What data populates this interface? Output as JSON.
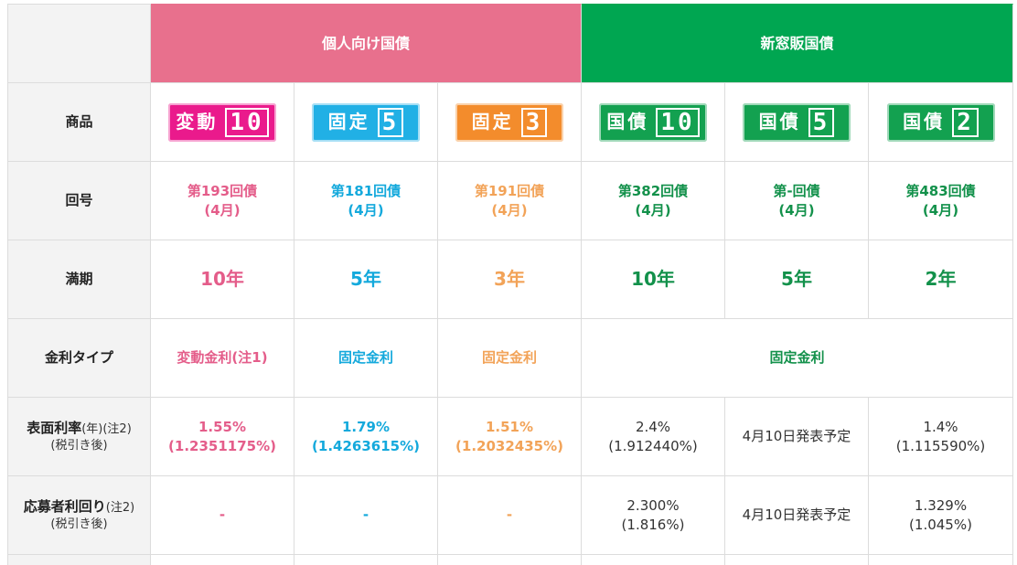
{
  "header": {
    "individual": "個人向け国債",
    "new_window": "新窓販国債"
  },
  "labels": {
    "product": "商品",
    "issue": "回号",
    "maturity": "満期",
    "rate_type": "金利タイプ",
    "coupon_main": "表面利率",
    "coupon_note": "(年)(注2)",
    "coupon_sub": "(税引き後)",
    "yield_main": "応募者利回り",
    "yield_note": "(注2)",
    "yield_sub": "(税引き後)"
  },
  "badges": [
    {
      "text": "変動",
      "num": "10",
      "color": "#ea1a8c"
    },
    {
      "text": "固定",
      "num": "5",
      "color": "#21b0e5"
    },
    {
      "text": "固定",
      "num": "3",
      "color": "#f38c2c"
    },
    {
      "text": "国債",
      "num": "10",
      "color": "#13a150"
    },
    {
      "text": "国債",
      "num": "5",
      "color": "#13a150"
    },
    {
      "text": "国債",
      "num": "2",
      "color": "#13a150"
    }
  ],
  "issues": [
    {
      "no": "第193回債",
      "month": "(4月)"
    },
    {
      "no": "第181回債",
      "month": "(4月)"
    },
    {
      "no": "第191回債",
      "month": "(4月)"
    },
    {
      "no": "第382回債",
      "month": "(4月)"
    },
    {
      "no": "第-回債",
      "month": "(4月)"
    },
    {
      "no": "第483回債",
      "month": "(4月)"
    }
  ],
  "maturities": [
    "10年",
    "5年",
    "3年",
    "10年",
    "5年",
    "2年"
  ],
  "rate_types": {
    "floating": "変動金利(注1)",
    "fixed5": "固定金利",
    "fixed3": "固定金利",
    "new_window": "固定金利"
  },
  "coupons": [
    {
      "main": "1.55%",
      "sub": "(1.2351175%)"
    },
    {
      "main": "1.79%",
      "sub": "(1.4263615%)"
    },
    {
      "main": "1.51%",
      "sub": "(1.2032435%)"
    },
    {
      "main": "2.4%",
      "sub": "(1.912440%)"
    },
    {
      "main": "4月10日発表予定",
      "sub": ""
    },
    {
      "main": "1.4%",
      "sub": "(1.115590%)"
    }
  ],
  "yields": [
    {
      "main": "-",
      "sub": ""
    },
    {
      "main": "-",
      "sub": ""
    },
    {
      "main": "-",
      "sub": ""
    },
    {
      "main": "2.300%",
      "sub": "(1.816%)"
    },
    {
      "main": "4月10日発表予定",
      "sub": ""
    },
    {
      "main": "1.329%",
      "sub": "(1.045%)"
    }
  ],
  "colors": {
    "pink_header": "#e8708d",
    "green_header": "#00a651",
    "pink_text": "#e45d8a",
    "blue_text": "#14a9dc",
    "orange_text": "#f2a358",
    "green_text": "#13914b"
  }
}
